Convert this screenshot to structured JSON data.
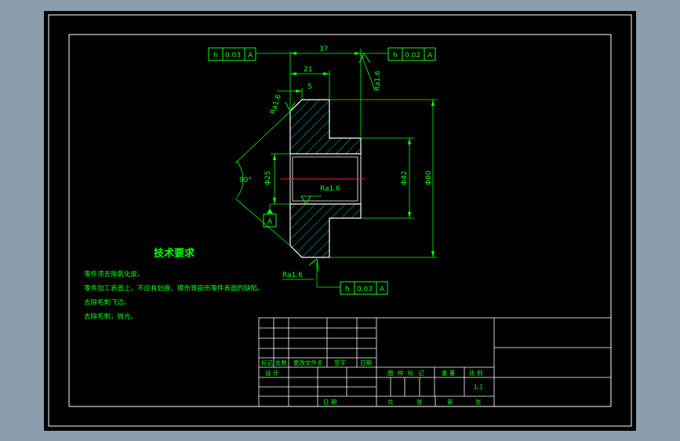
{
  "colors": {
    "background": "#8c9dad",
    "sheet": "#000000",
    "border": "#ffffff",
    "geometry": "#ffffff",
    "dimension": "#00ff00",
    "hatch": "#00c8c8",
    "centerline": "#ff2020",
    "text": "#00ff00"
  },
  "dimensions": {
    "overall_length": "37",
    "hub_length": "21",
    "chamfer_offset": "5",
    "bore_diameter": "Φ25",
    "hub_diameter": "Φ42",
    "outer_diameter": "Φ80",
    "chamfer_angle": "90°"
  },
  "tolerances": [
    {
      "symbol": "h",
      "value": "0.03",
      "datum": "A"
    },
    {
      "symbol": "h",
      "value": "0.02",
      "datum": "A"
    },
    {
      "symbol": "h",
      "value": "0.03",
      "datum": "A"
    }
  ],
  "roughness": [
    "Ra1.6",
    "Ra1.6",
    "Ra1.6",
    "Ra1.6"
  ],
  "datum_label": "A",
  "requirements": {
    "title": "技术要求",
    "items": [
      "零件须去除氧化皮。",
      "零件加工表面上，不应有划痕、擦伤等损伤零件表面的缺陷。",
      "去除毛刺飞边。",
      "去除毛刺，抛光。"
    ]
  },
  "title_block": {
    "rev_headers": [
      "标记",
      "处数",
      "更改文件名",
      "签字",
      "日期"
    ],
    "design": "设 计",
    "date": "日 期",
    "stage_labels": [
      "图",
      "样",
      "标",
      "记"
    ],
    "weight": "重 量",
    "scale": "比 例",
    "scale_value": "1:1",
    "sheets": [
      "共",
      "张",
      "第",
      "张"
    ]
  }
}
